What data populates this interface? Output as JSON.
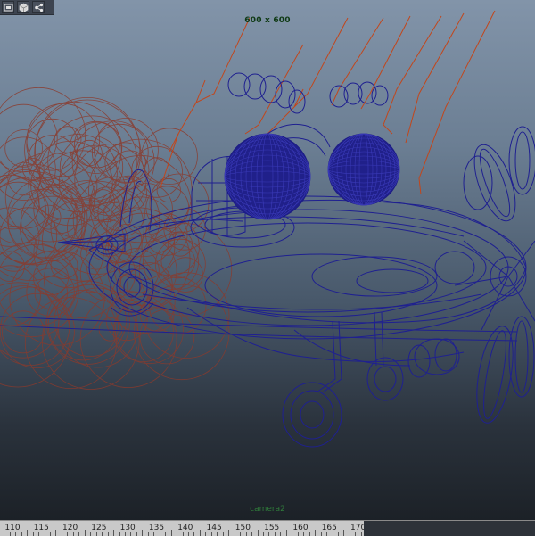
{
  "viewport": {
    "resolution_gate": "600 x 600",
    "camera_name": "camera2"
  },
  "toolbar": {
    "buttons": [
      {
        "name": "camera-attributes",
        "icon": "camera-frame-icon"
      },
      {
        "name": "shaded-view",
        "icon": "cube-icon"
      },
      {
        "name": "isolate-select",
        "icon": "graph-nodes-icon"
      }
    ]
  },
  "timeline": {
    "ticks": [
      "110",
      "115",
      "120",
      "125",
      "130",
      "135",
      "140",
      "145",
      "150",
      "155",
      "160",
      "165",
      "170"
    ]
  },
  "colors": {
    "wireframe": "#1e1f8f",
    "selected_wire": "#b8441a",
    "smoke": "#8b3a2c",
    "viewport_top": "#8294a9",
    "viewport_bottom": "#1c2127"
  }
}
